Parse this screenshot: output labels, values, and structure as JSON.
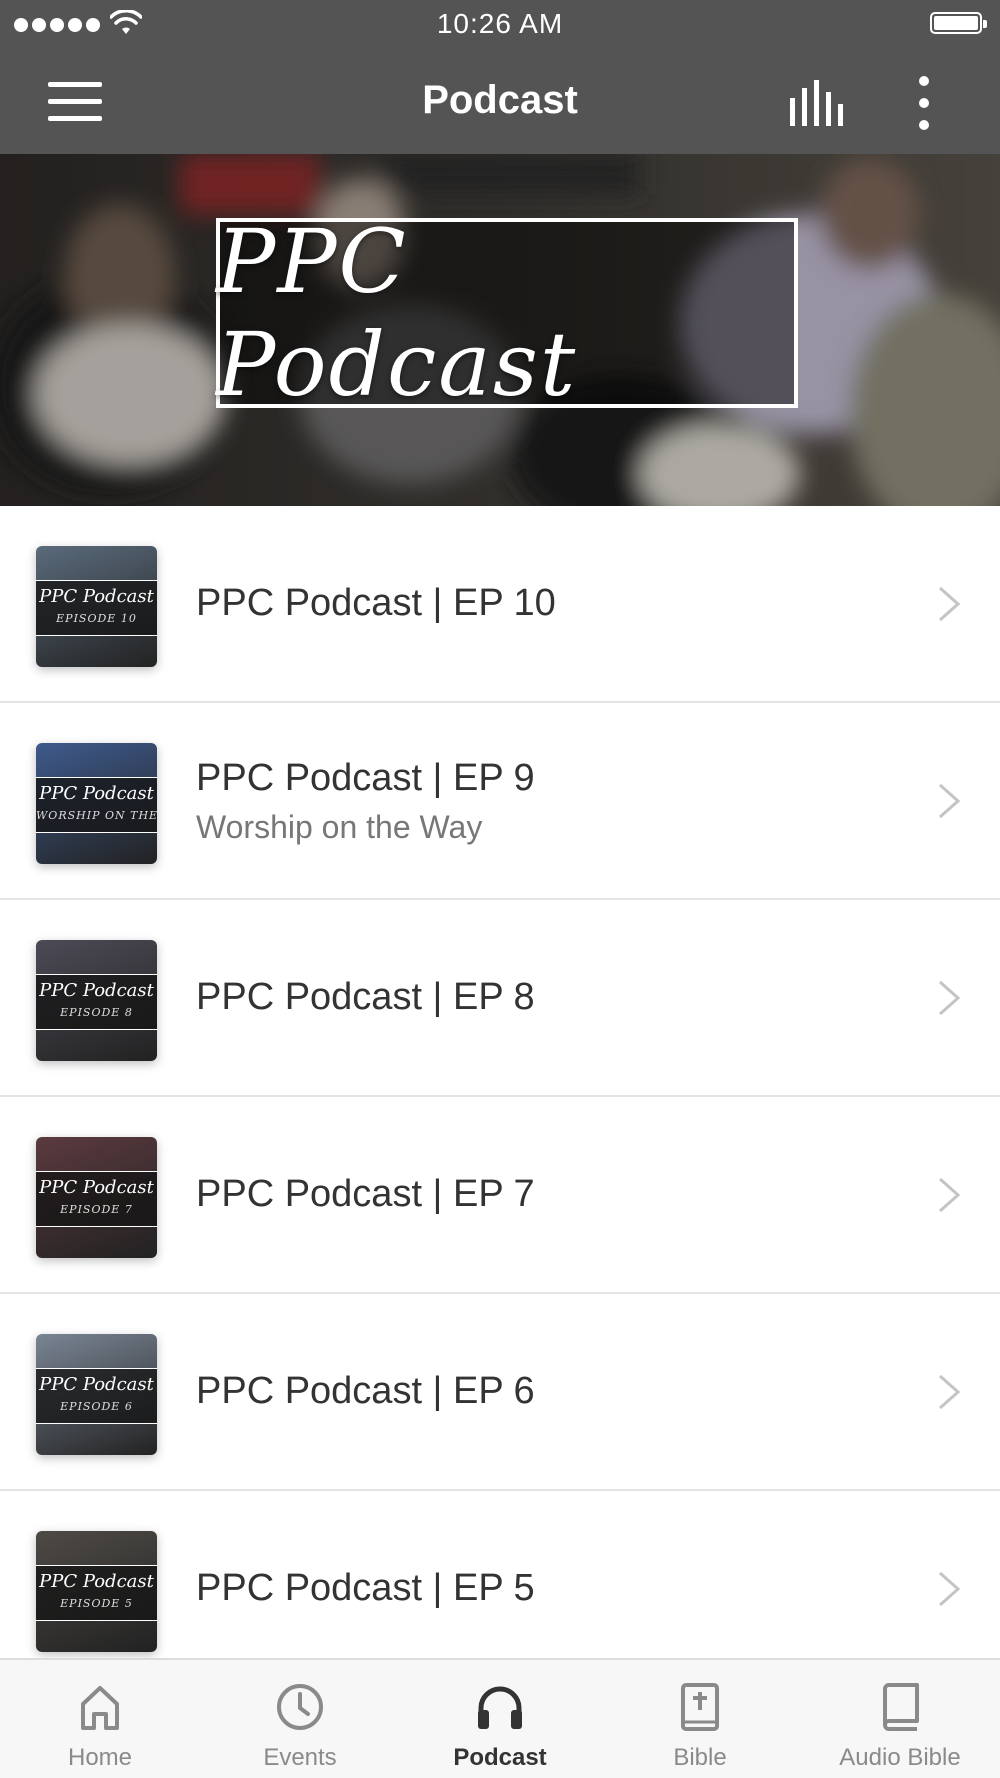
{
  "status_bar": {
    "time": "10:26 AM"
  },
  "header": {
    "title": "Podcast",
    "icons": [
      "menu-icon",
      "equalizer-icon",
      "more-vertical-icon"
    ]
  },
  "hero": {
    "title": "PPC Podcast"
  },
  "episodes": [
    {
      "title": "PPC Podcast | EP 10",
      "subtitle": "",
      "thumb_title": "PPC Podcast",
      "thumb_caption": "EPISODE 10",
      "thumb_color": "#5a6b7c"
    },
    {
      "title": "PPC Podcast | EP 9",
      "subtitle": "Worship on the Way",
      "thumb_title": "PPC Podcast",
      "thumb_caption": "WORSHIP ON THE WAY",
      "thumb_color": "#3e5a8c"
    },
    {
      "title": "PPC Podcast | EP 8",
      "subtitle": "",
      "thumb_title": "PPC Podcast",
      "thumb_caption": "EPISODE 8",
      "thumb_color": "#4c4a55"
    },
    {
      "title": "PPC Podcast | EP 7",
      "subtitle": "",
      "thumb_title": "PPC Podcast",
      "thumb_caption": "EPISODE 7",
      "thumb_color": "#5b3a3e"
    },
    {
      "title": "PPC Podcast | EP 6",
      "subtitle": "",
      "thumb_title": "PPC Podcast",
      "thumb_caption": "EPISODE 6",
      "thumb_color": "#7a8594"
    },
    {
      "title": "PPC Podcast | EP 5",
      "subtitle": "",
      "thumb_title": "PPC Podcast",
      "thumb_caption": "EPISODE 5",
      "thumb_color": "#4e4a46"
    }
  ],
  "tabs": [
    {
      "label": "Home",
      "icon": "home-icon",
      "active": false
    },
    {
      "label": "Events",
      "icon": "clock-icon",
      "active": false
    },
    {
      "label": "Podcast",
      "icon": "headphones-icon",
      "active": true
    },
    {
      "label": "Bible",
      "icon": "bible-icon",
      "active": false
    },
    {
      "label": "Audio Bible",
      "icon": "book-icon",
      "active": false
    }
  ],
  "colors": {
    "app_bar": "#545454",
    "active_tab": "#333333",
    "inactive_tab": "#8a8a8a",
    "divider": "#e4e4e4"
  }
}
